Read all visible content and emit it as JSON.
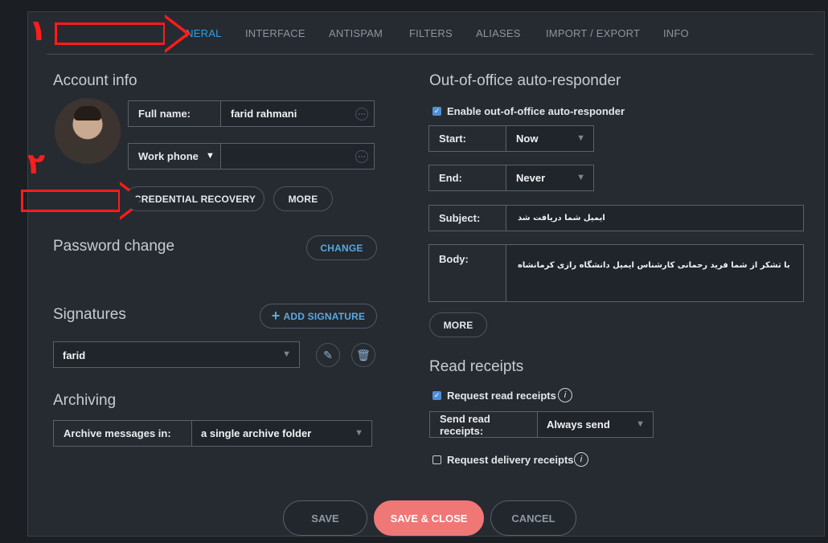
{
  "tabs": [
    "GENERAL",
    "INTERFACE",
    "ANTISPAM",
    "FILTERS",
    "ALIASES",
    "IMPORT / EXPORT",
    "INFO"
  ],
  "annotations": {
    "one": "١",
    "two": "٢"
  },
  "account": {
    "title": "Account info",
    "full_name_label": "Full name:",
    "full_name_value": "farid rahmani",
    "work_phone_label": "Work phone",
    "credential_recovery": "CREDENTIAL RECOVERY",
    "more": "MORE"
  },
  "password": {
    "title": "Password change",
    "change": "CHANGE"
  },
  "signatures": {
    "title": "Signatures",
    "add": "ADD SIGNATURE",
    "selected": "farid"
  },
  "archiving": {
    "title": "Archiving",
    "label": "Archive messages in:",
    "value": "a single archive folder"
  },
  "ooo": {
    "title": "Out-of-office auto-responder",
    "enable": "Enable out-of-office auto-responder",
    "start_label": "Start:",
    "start_value": "Now",
    "end_label": "End:",
    "end_value": "Never",
    "subject_label": "Subject:",
    "subject_value": "ایمیل شما دریافت شد",
    "body_label": "Body:",
    "body_value": "با تشکر از شما فرید رحمانی کارشناس ایمیل دانشگاه رازی کرمانشاه",
    "more": "MORE"
  },
  "receipts": {
    "title": "Read receipts",
    "request_read": "Request read receipts",
    "send_label": "Send read receipts:",
    "send_value": "Always send",
    "request_delivery": "Request delivery receipts"
  },
  "footer": {
    "save": "SAVE",
    "save_close": "SAVE & CLOSE",
    "cancel": "CANCEL"
  },
  "icons": {
    "check": "✓",
    "info": "i",
    "chevron": "▼",
    "edit": "✎",
    "trash": "🗑",
    "ellipsis": "⋯",
    "plus": "+"
  }
}
